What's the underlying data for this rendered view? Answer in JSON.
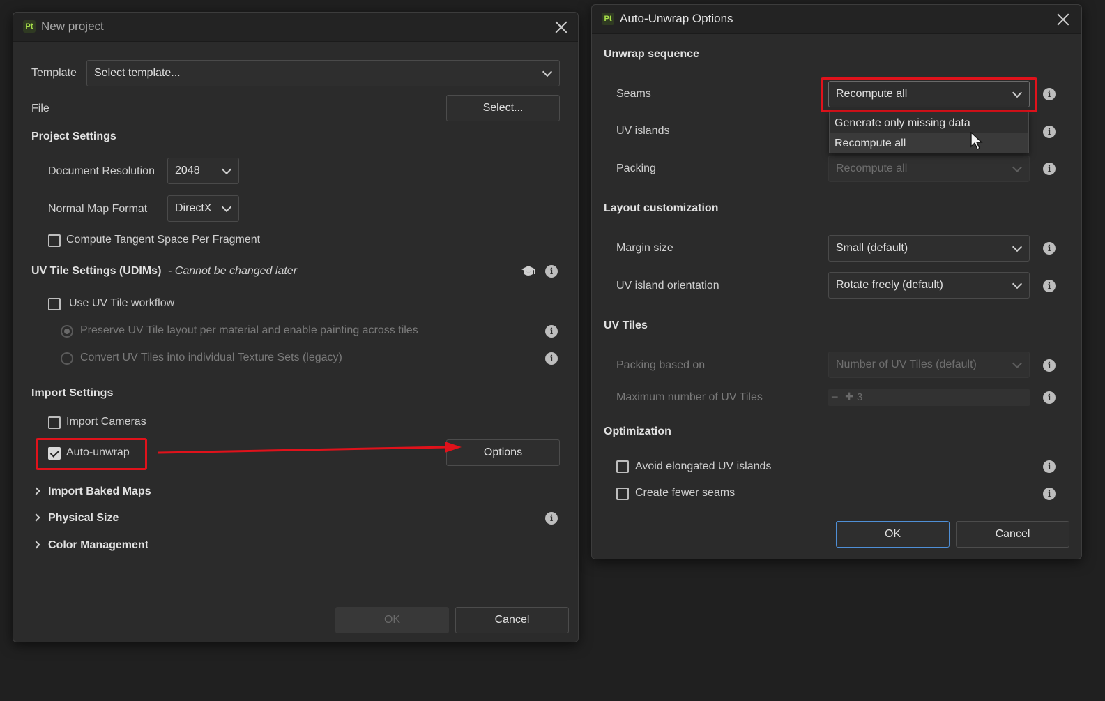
{
  "new_project": {
    "title": "New project",
    "template_label": "Template",
    "template_value": "Select template...",
    "file_label": "File",
    "file_select_label": "Select...",
    "project_settings": "Project Settings",
    "doc_resolution_label": "Document Resolution",
    "doc_resolution_value": "2048",
    "normal_map_label": "Normal Map Format",
    "normal_map_value": "DirectX",
    "tangent_label": "Compute Tangent Space Per Fragment",
    "uv_tile_heading": "UV Tile Settings (UDIMs)",
    "uv_tile_note": "- Cannot be changed later",
    "use_uv_tile_label": "Use UV Tile workflow",
    "preserve_label": "Preserve UV Tile layout per material and enable painting across tiles",
    "convert_label": "Convert UV Tiles into individual Texture Sets (legacy)",
    "import_settings": "Import Settings",
    "import_cameras_label": "Import Cameras",
    "auto_unwrap_label": "Auto-unwrap",
    "options_label": "Options",
    "import_baked_maps": "Import Baked Maps",
    "physical_size": "Physical Size",
    "color_management": "Color Management",
    "ok_label": "OK",
    "cancel_label": "Cancel"
  },
  "auto_unwrap": {
    "title": "Auto-Unwrap Options",
    "unwrap_sequence": "Unwrap sequence",
    "seams_label": "Seams",
    "seams_value": "Recompute all",
    "seams_options": [
      "Generate only missing data",
      "Recompute all"
    ],
    "uv_islands_label": "UV islands",
    "packing_label": "Packing",
    "packing_value": "Recompute all",
    "layout_customization": "Layout customization",
    "margin_label": "Margin size",
    "margin_value": "Small (default)",
    "orientation_label": "UV island orientation",
    "orientation_value": "Rotate freely (default)",
    "uv_tiles": "UV Tiles",
    "packing_based_label": "Packing based on",
    "packing_based_value": "Number of UV Tiles (default)",
    "max_tiles_label": "Maximum number of UV Tiles",
    "max_tiles_value": "3",
    "spin_minus": "−",
    "spin_plus": "+",
    "optimization": "Optimization",
    "avoid_label": "Avoid elongated UV islands",
    "fewer_seams_label": "Create fewer seams",
    "ok_label": "OK",
    "cancel_label": "Cancel"
  },
  "icons": {
    "app_logo": "Pt",
    "info": "i",
    "academy": "graduation-cap"
  },
  "colors": {
    "highlight": "#e0121b",
    "primary_border": "#4f8fd6",
    "app_logo": "#a8e04a"
  }
}
